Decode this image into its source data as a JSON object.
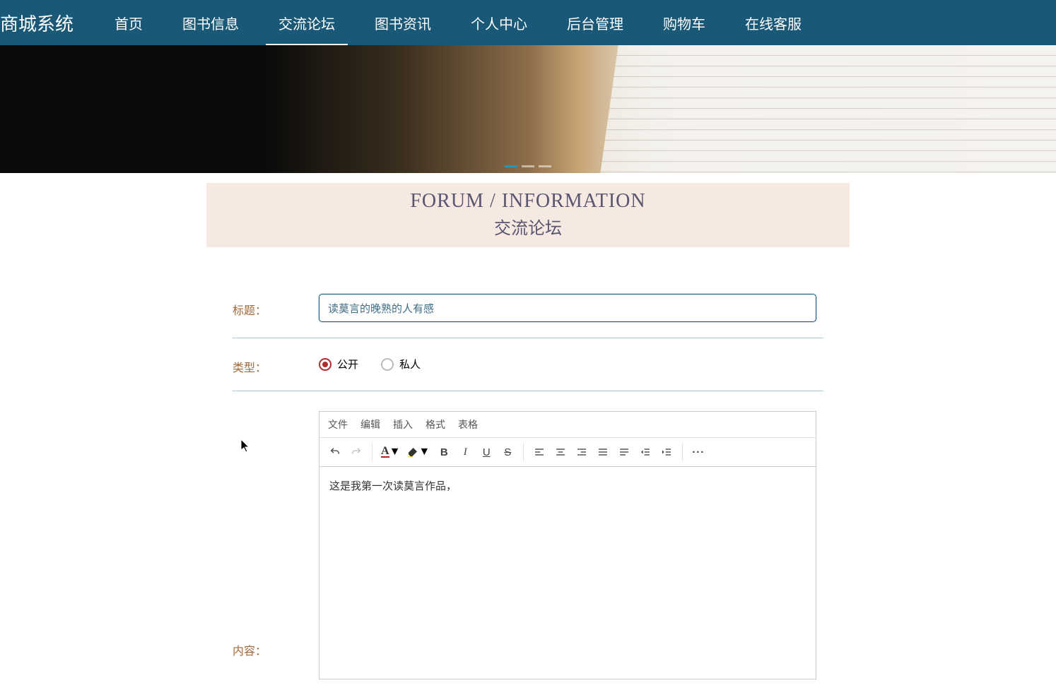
{
  "brand": "商城系统",
  "nav": {
    "home": "首页",
    "books": "图书信息",
    "forum": "交流论坛",
    "news": "图书资讯",
    "user": "个人中心",
    "admin": "后台管理",
    "cart": "购物车",
    "service": "在线客服"
  },
  "headingEn": "FORUM / INFORMATION",
  "headingZh": "交流论坛",
  "labels": {
    "title": "标题：",
    "type": "类型：",
    "content": "内容："
  },
  "form": {
    "titleValue": "读莫言的晚熟的人有感",
    "typePublic": "公开",
    "typePrivate": "私人",
    "editorContent": "这是我第一次读莫言作品，"
  },
  "editorMenu": {
    "file": "文件",
    "edit": "编辑",
    "insert": "插入",
    "format": "格式",
    "table": "表格"
  },
  "colors": {
    "brand": "#1a5878",
    "accent": "#b02d2d"
  }
}
